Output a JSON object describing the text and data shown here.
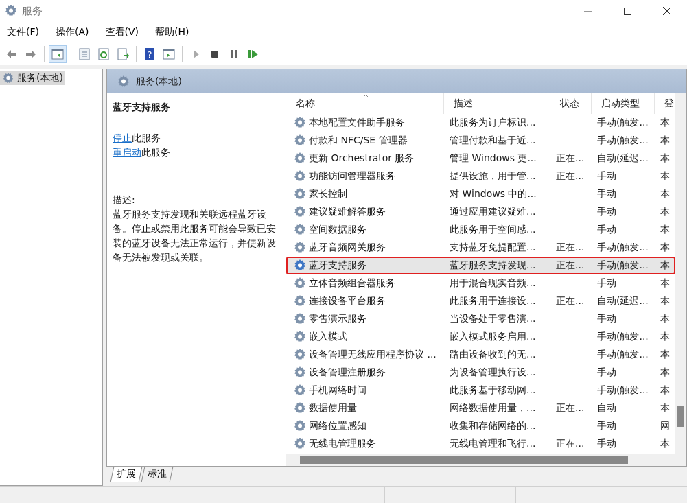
{
  "window": {
    "title": "服务"
  },
  "menu": [
    "文件(F)",
    "操作(A)",
    "查看(V)",
    "帮助(H)"
  ],
  "toolbar": {
    "help_glyph": "?"
  },
  "tree": {
    "items": [
      {
        "label": "服务(本地)",
        "selected": true
      }
    ]
  },
  "panel": {
    "title": "服务(本地)"
  },
  "details": {
    "service_name": "蓝牙支持服务",
    "actions": [
      {
        "link": "停止",
        "text": "此服务"
      },
      {
        "link": "重启动",
        "text": "此服务"
      }
    ],
    "description_label": "描述:",
    "description": "蓝牙服务支持发现和关联远程蓝牙设备。停止或禁用此服务可能会导致已安装的蓝牙设备无法正常运行，并使新设备无法被发现或关联。"
  },
  "table": {
    "columns": [
      "名称",
      "描述",
      "状态",
      "启动类型",
      "登"
    ],
    "rows": [
      {
        "name": "本地配置文件助手服务",
        "description": "此服务为订户标识...",
        "status": "",
        "startup": "手动(触发...",
        "logon": "本",
        "selected": false
      },
      {
        "name": "付款和 NFC/SE 管理器",
        "description": "管理付款和基于近...",
        "status": "",
        "startup": "手动(触发...",
        "logon": "本",
        "selected": false
      },
      {
        "name": "更新 Orchestrator 服务",
        "description": "管理 Windows 更...",
        "status": "正在...",
        "startup": "自动(延迟...",
        "logon": "本",
        "selected": false
      },
      {
        "name": "功能访问管理器服务",
        "description": "提供设施，用于管...",
        "status": "正在...",
        "startup": "手动",
        "logon": "本",
        "selected": false
      },
      {
        "name": "家长控制",
        "description": "对 Windows 中的...",
        "status": "",
        "startup": "手动",
        "logon": "本",
        "selected": false
      },
      {
        "name": "建议疑难解答服务",
        "description": "通过应用建议疑难...",
        "status": "",
        "startup": "手动",
        "logon": "本",
        "selected": false
      },
      {
        "name": "空间数据服务",
        "description": "此服务用于空间感...",
        "status": "",
        "startup": "手动",
        "logon": "本",
        "selected": false
      },
      {
        "name": "蓝牙音频网关服务",
        "description": "支持蓝牙免提配置...",
        "status": "正在...",
        "startup": "手动(触发...",
        "logon": "本",
        "selected": false
      },
      {
        "name": "蓝牙支持服务",
        "description": "蓝牙服务支持发现...",
        "status": "正在...",
        "startup": "手动(触发...",
        "logon": "本",
        "selected": true
      },
      {
        "name": "立体音频组合器服务",
        "description": "用于混合现实音频...",
        "status": "",
        "startup": "手动",
        "logon": "本",
        "selected": false
      },
      {
        "name": "连接设备平台服务",
        "description": "此服务用于连接设...",
        "status": "正在...",
        "startup": "自动(延迟...",
        "logon": "本",
        "selected": false
      },
      {
        "name": "零售演示服务",
        "description": "当设备处于零售演...",
        "status": "",
        "startup": "手动",
        "logon": "本",
        "selected": false
      },
      {
        "name": "嵌入模式",
        "description": "嵌入模式服务启用...",
        "status": "",
        "startup": "手动(触发...",
        "logon": "本",
        "selected": false
      },
      {
        "name": "设备管理无线应用程序协议 ...",
        "description": "路由设备收到的无...",
        "status": "",
        "startup": "手动(触发...",
        "logon": "本",
        "selected": false
      },
      {
        "name": "设备管理注册服务",
        "description": "为设备管理执行设...",
        "status": "",
        "startup": "手动",
        "logon": "本",
        "selected": false
      },
      {
        "name": "手机网络时间",
        "description": "此服务基于移动网...",
        "status": "",
        "startup": "手动(触发...",
        "logon": "本",
        "selected": false
      },
      {
        "name": "数据使用量",
        "description": "网络数据使用量，...",
        "status": "正在...",
        "startup": "自动",
        "logon": "本",
        "selected": false
      },
      {
        "name": "网络位置感知",
        "description": "收集和存储网络的...",
        "status": "",
        "startup": "手动",
        "logon": "网",
        "selected": false
      },
      {
        "name": "无线电管理服务",
        "description": "无线电管理和飞行...",
        "status": "正在...",
        "startup": "手动",
        "logon": "本",
        "selected": false
      }
    ]
  },
  "bottom_tabs": [
    {
      "label": "扩展",
      "selected": true
    },
    {
      "label": "标准",
      "selected": false
    }
  ]
}
